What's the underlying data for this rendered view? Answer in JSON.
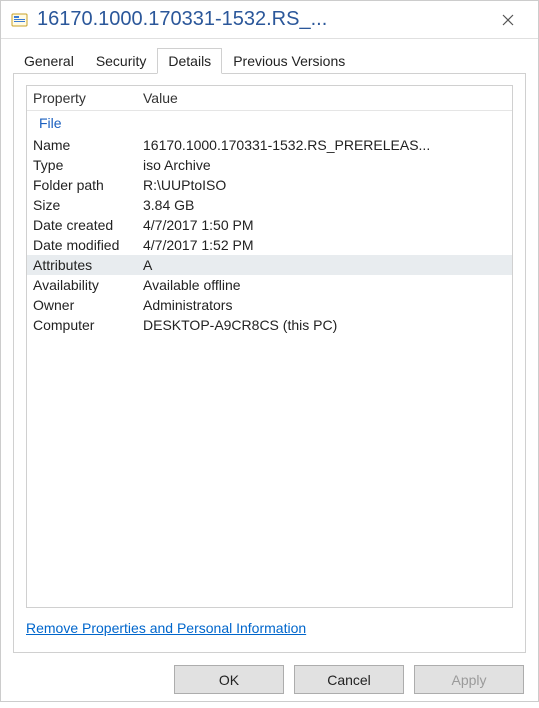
{
  "titlebar": {
    "title": "16170.1000.170331-1532.RS_..."
  },
  "tabs": [
    {
      "label": "General",
      "active": false
    },
    {
      "label": "Security",
      "active": false
    },
    {
      "label": "Details",
      "active": true
    },
    {
      "label": "Previous Versions",
      "active": false
    }
  ],
  "details": {
    "header_property": "Property",
    "header_value": "Value",
    "group_label": "File",
    "rows": [
      {
        "prop": "Name",
        "val": "16170.1000.170331-1532.RS_PRERELEAS...",
        "selected": false
      },
      {
        "prop": "Type",
        "val": "iso Archive",
        "selected": false
      },
      {
        "prop": "Folder path",
        "val": "R:\\UUPtoISO",
        "selected": false
      },
      {
        "prop": "Size",
        "val": "3.84 GB",
        "selected": false
      },
      {
        "prop": "Date created",
        "val": "4/7/2017 1:50 PM",
        "selected": false
      },
      {
        "prop": "Date modified",
        "val": "4/7/2017 1:52 PM",
        "selected": false
      },
      {
        "prop": "Attributes",
        "val": "A",
        "selected": true
      },
      {
        "prop": "Availability",
        "val": "Available offline",
        "selected": false
      },
      {
        "prop": "Owner",
        "val": "Administrators",
        "selected": false
      },
      {
        "prop": "Computer",
        "val": "DESKTOP-A9CR8CS (this PC)",
        "selected": false
      }
    ]
  },
  "links": {
    "remove_props": "Remove Properties and Personal Information"
  },
  "buttons": {
    "ok": "OK",
    "cancel": "Cancel",
    "apply": "Apply"
  }
}
